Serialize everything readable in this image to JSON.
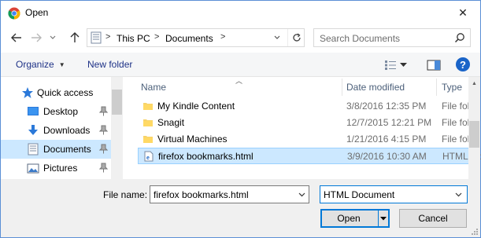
{
  "window": {
    "title": "Open",
    "close_glyph": "✕"
  },
  "nav": {
    "address": {
      "segments": [
        "This PC",
        "Documents"
      ],
      "separator": ">"
    },
    "search": {
      "placeholder": "Search Documents"
    }
  },
  "toolbar": {
    "organize_label": "Organize",
    "new_folder_label": "New folder"
  },
  "navpane": {
    "items": [
      {
        "label": "Quick access",
        "icon": "star-icon",
        "selected": false,
        "pinned": false
      },
      {
        "label": "Desktop",
        "icon": "desktop-icon",
        "selected": false,
        "pinned": true
      },
      {
        "label": "Downloads",
        "icon": "download-icon",
        "selected": false,
        "pinned": true
      },
      {
        "label": "Documents",
        "icon": "documents-icon",
        "selected": true,
        "pinned": true
      },
      {
        "label": "Pictures",
        "icon": "pictures-icon",
        "selected": false,
        "pinned": true
      }
    ]
  },
  "filelist": {
    "columns": [
      "Name",
      "Date modified",
      "Type"
    ],
    "rows": [
      {
        "name": "My Kindle Content",
        "date": "3/8/2016 12:35 PM",
        "type": "File fold",
        "icon": "folder-icon",
        "selected": false
      },
      {
        "name": "Snagit",
        "date": "12/7/2015 12:21 PM",
        "type": "File fold",
        "icon": "folder-icon",
        "selected": false
      },
      {
        "name": "Virtual Machines",
        "date": "1/21/2016 4:15 PM",
        "type": "File fold",
        "icon": "folder-icon",
        "selected": false
      },
      {
        "name": "firefox bookmarks.html",
        "date": "3/9/2016 10:30 AM",
        "type": "HTML Do",
        "icon": "html-file-icon",
        "selected": true
      }
    ]
  },
  "bottom": {
    "file_name_label": "File name:",
    "file_name_value": "firefox bookmarks.html",
    "file_type_value": "HTML Document",
    "open_label": "Open",
    "cancel_label": "Cancel"
  },
  "colors": {
    "selection": "#cce8ff",
    "accent": "#0078d7",
    "link_text": "#1e3287"
  }
}
